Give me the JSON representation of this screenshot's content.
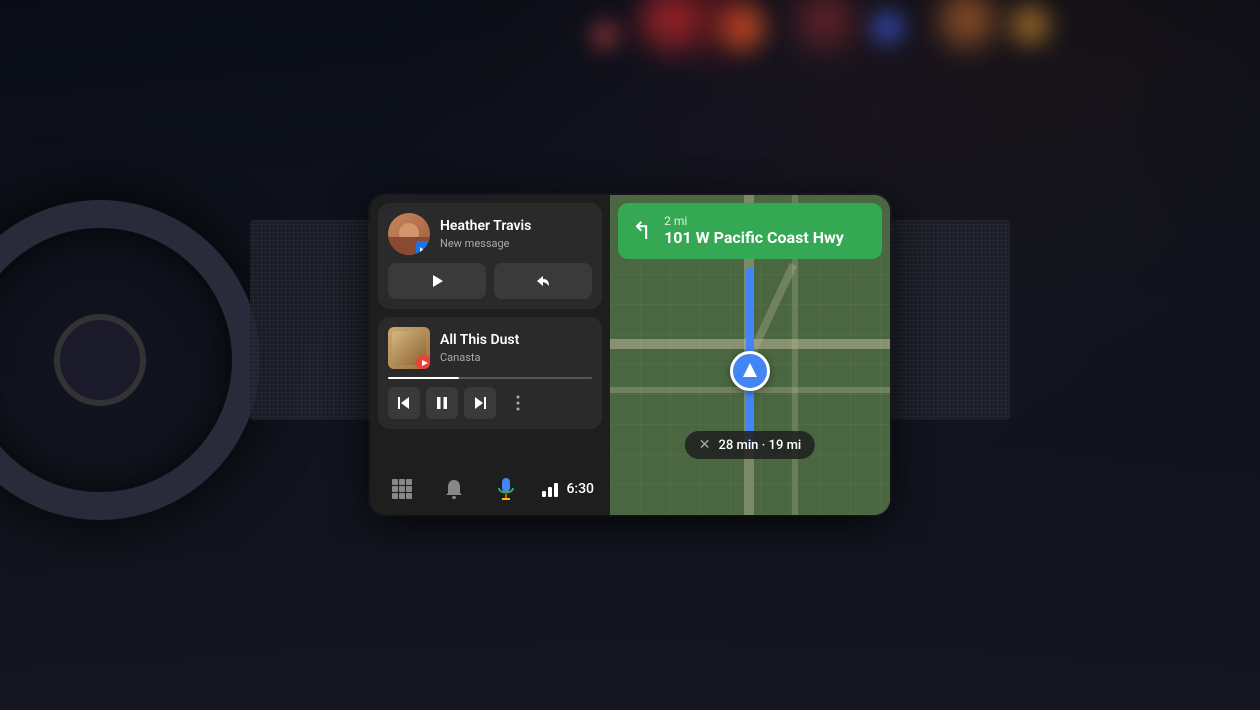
{
  "background": {
    "bokeh_colors": [
      "#ff4444",
      "#ff8844",
      "#4488ff",
      "#ff6644",
      "#44aaff",
      "#ffaa44"
    ]
  },
  "screen": {
    "message_card": {
      "contact_name": "Heather Travis",
      "subtitle": "New message",
      "play_label": "play",
      "reply_label": "reply"
    },
    "music_card": {
      "track_title": "All This Dust",
      "artist": "Canasta",
      "progress": 35
    },
    "navigation": {
      "distance": "2 mi",
      "street": "101 W Pacific Coast Hwy",
      "eta_text": "28 min · 19 mi"
    },
    "bottom_nav": {
      "apps_label": "apps",
      "notifications_label": "notifications",
      "assistant_label": "assistant",
      "time": "6:30"
    }
  }
}
